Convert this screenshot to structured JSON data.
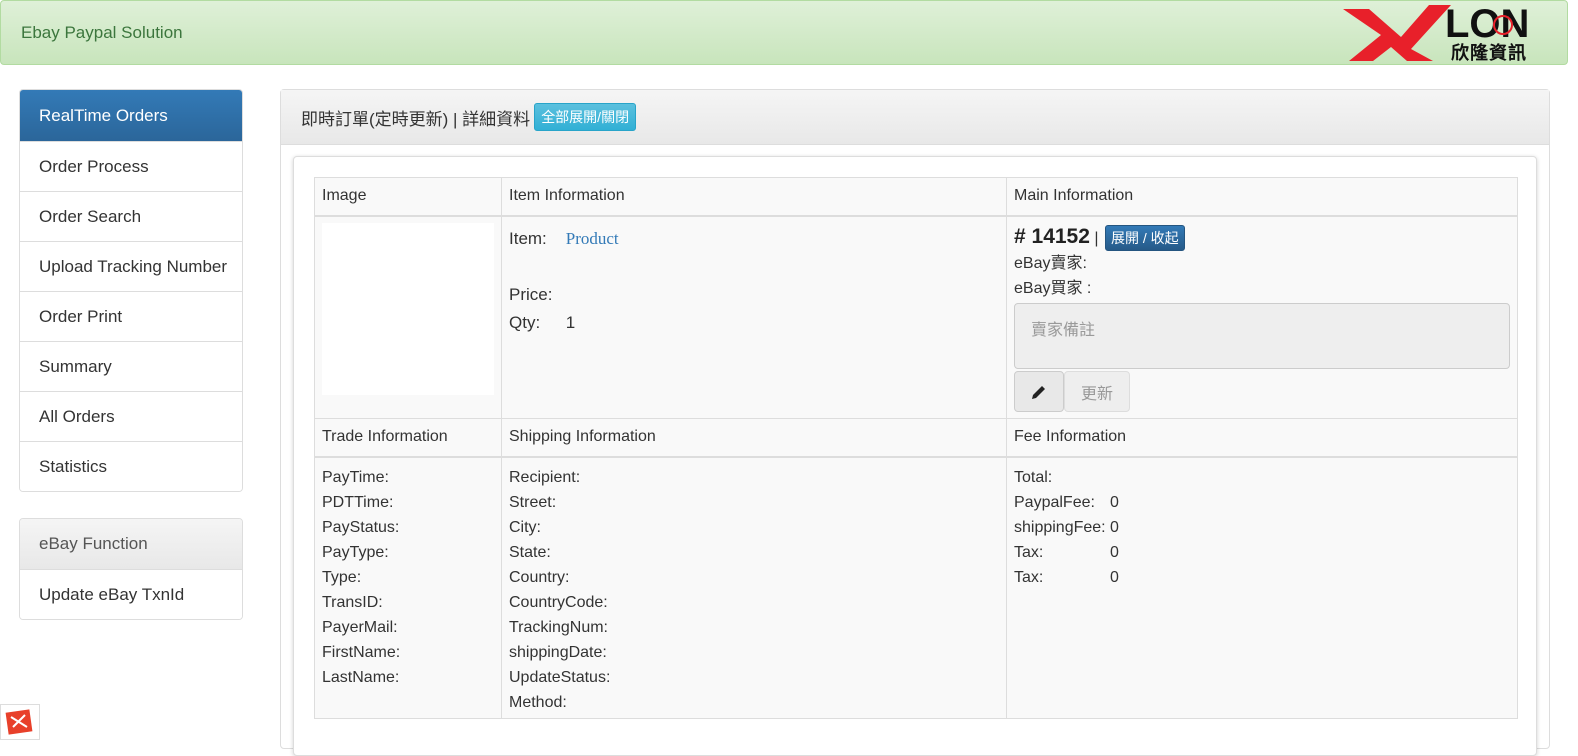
{
  "header": {
    "brand": "Ebay Paypal Solution",
    "logo_sub": "欣隆資訊",
    "logo_letters": "LON"
  },
  "sidebar": {
    "items": [
      {
        "label": "RealTime Orders",
        "active": true
      },
      {
        "label": "Order Process"
      },
      {
        "label": "Order Search"
      },
      {
        "label": "Upload Tracking Number"
      },
      {
        "label": "Order Print"
      },
      {
        "label": "Summary"
      },
      {
        "label": "All Orders"
      },
      {
        "label": "Statistics"
      }
    ],
    "ebay_heading": "eBay Function",
    "ebay_items": [
      {
        "label": "Update eBay TxnId"
      }
    ]
  },
  "panel": {
    "title": "即時訂單(定時更新) | 詳細資料",
    "toggle_all": "全部展開/關閉"
  },
  "table": {
    "headers": {
      "image": "Image",
      "item": "Item Information",
      "main": "Main Information"
    },
    "item": {
      "item_label": "Item:",
      "product": "Product",
      "price_label": "Price:",
      "qty_label": "Qty:",
      "qty_value": "1"
    },
    "main": {
      "order_no": "# 14152",
      "sep": "|",
      "expand_btn": "展開 / 收起",
      "seller_label": "eBay賣家:",
      "buyer_label": "eBay買家 :",
      "note_placeholder": "賣家備註",
      "update_btn": "更新"
    },
    "sections": {
      "trade": "Trade Information",
      "shipping": "Shipping Information",
      "fee": "Fee Information"
    },
    "trade_fields": [
      "PayTime:",
      "PDTTime:",
      "PayStatus:",
      "PayType:",
      "Type:",
      "TransID:",
      "PayerMail:",
      "FirstName:",
      "LastName:"
    ],
    "shipping_fields": [
      "Recipient:",
      "Street:",
      "City:",
      "State:",
      "Country:",
      "CountryCode:",
      "TrackingNum:",
      "shippingDate:",
      "UpdateStatus:",
      "Method:"
    ],
    "fee_fields": [
      {
        "label": "Total:",
        "value": ""
      },
      {
        "label": "PaypalFee:",
        "value": "0"
      },
      {
        "label": "shippingFee:",
        "value": "0"
      },
      {
        "label": "Tax:",
        "value": "0"
      },
      {
        "label": "Tax:",
        "value": "0"
      }
    ]
  },
  "colors": {
    "primary": "#337ab7",
    "info": "#5bc0de",
    "header_bg": "#dff0d8",
    "logo_red": "#e8202a"
  }
}
